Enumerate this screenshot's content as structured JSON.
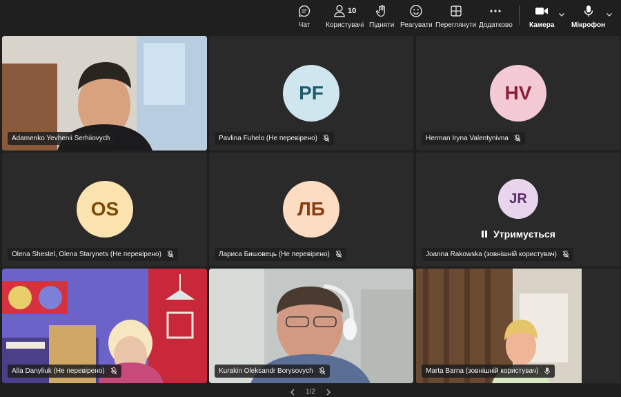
{
  "toolbar": {
    "chat": {
      "label": "Чат",
      "icon": "chat-icon"
    },
    "people": {
      "label": "Користувачі",
      "count": "10",
      "icon": "people-icon"
    },
    "raise": {
      "label": "Підняти",
      "icon": "raise-hand-icon"
    },
    "react": {
      "label": "Реагувати",
      "icon": "smiley-icon"
    },
    "view": {
      "label": "Переглянути",
      "icon": "grid-icon"
    },
    "more": {
      "label": "Додатково",
      "icon": "more-icon"
    },
    "camera": {
      "label": "Камера",
      "icon": "camera-icon"
    },
    "mic": {
      "label": "Мікрофон",
      "icon": "microphone-icon"
    }
  },
  "participants": [
    {
      "name": "Adamenko Yevhenii Serhiiovych",
      "video": true,
      "muted": false
    },
    {
      "name": "Pavlina Fuhelo (Не перевірено)",
      "initials": "PF",
      "avatar_bg": "#cfe6ee",
      "avatar_fg": "#1f5a6e",
      "muted": true
    },
    {
      "name": "Herman Iryna Valentynivna",
      "initials": "HV",
      "avatar_bg": "#f3c9d4",
      "avatar_fg": "#8a1f3a",
      "muted": true
    },
    {
      "name": "Olena Shestel, Olena Starynets (Не перевірено)",
      "initials": "OS",
      "avatar_bg": "#fbe3b0",
      "avatar_fg": "#7a4a09",
      "muted": true
    },
    {
      "name": "Лариса Бишовець (Не перевірено)",
      "initials": "ЛБ",
      "avatar_bg": "#fddcc4",
      "avatar_fg": "#8a3b10",
      "muted": true
    },
    {
      "name": "Joanna Rakowska (зовнішній користувач)",
      "initials": "JR",
      "avatar_bg": "#e6d5ec",
      "avatar_fg": "#5a2b6c",
      "muted": true,
      "status": "Утримується"
    },
    {
      "name": "Alla Danyliuk (Не перевірено)",
      "video": true,
      "muted": true
    },
    {
      "name": "Kurakin Oleksandr Borysovych",
      "video": true,
      "muted": true
    },
    {
      "name": "Marta Barna (зовнішній користувач)",
      "video": true,
      "muted": false,
      "speaking": true
    }
  ],
  "pager": {
    "text": "1/2"
  }
}
